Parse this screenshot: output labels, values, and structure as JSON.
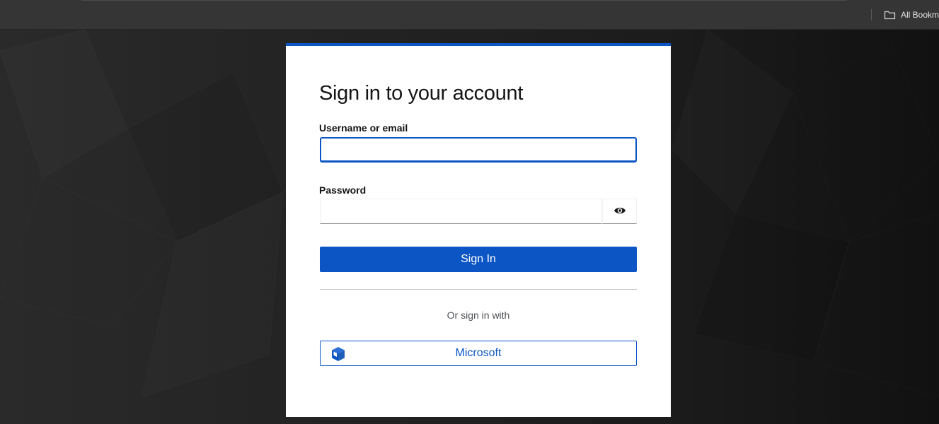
{
  "browser": {
    "bookmarks_label": "All Bookm"
  },
  "login": {
    "title": "Sign in to your account",
    "username_label": "Username or email",
    "username_value": "",
    "password_label": "Password",
    "password_value": "",
    "signin_label": "Sign In",
    "or_text": "Or sign in with",
    "social_provider_label": "Microsoft"
  },
  "icons": {
    "bookmarks": "folder-icon",
    "password_toggle": "eye-icon",
    "provider": "cube-icon"
  },
  "colors": {
    "accent": "#0b55c4",
    "card_background": "#ffffff",
    "page_background": "#1b1b1b",
    "toolbar": "#353535"
  }
}
